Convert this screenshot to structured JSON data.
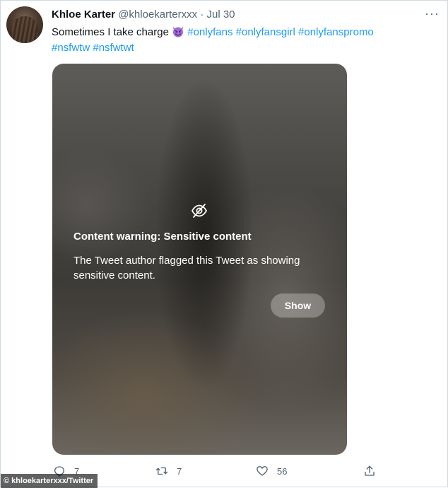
{
  "tweet": {
    "author_name": "Khloe Karter",
    "author_handle": "@khloekarterxxx",
    "separator": "·",
    "date": "Jul 30",
    "more_label": "···",
    "text_prefix": "Sometimes I take charge",
    "emoji": "smiling-devil-emoji",
    "hashtags": [
      "#onlyfans",
      "#onlyfansgirl",
      "#onlyfanspromo",
      "#nsfwtw",
      "#nsfwtwt"
    ]
  },
  "media": {
    "icon": "eye-slash-icon",
    "warning_title": "Content warning: Sensitive content",
    "warning_body": "The Tweet author flagged this Tweet as showing sensitive content.",
    "show_label": "Show"
  },
  "actions": {
    "reply_count": "7",
    "retweet_count": "7",
    "like_count": "56"
  },
  "credit": "khloekarterxxx/Twitter",
  "colors": {
    "hashtag": "#1d9bf0",
    "secondary_text": "#536471",
    "primary_text": "#0f1419",
    "credit_bg": "#000000"
  }
}
